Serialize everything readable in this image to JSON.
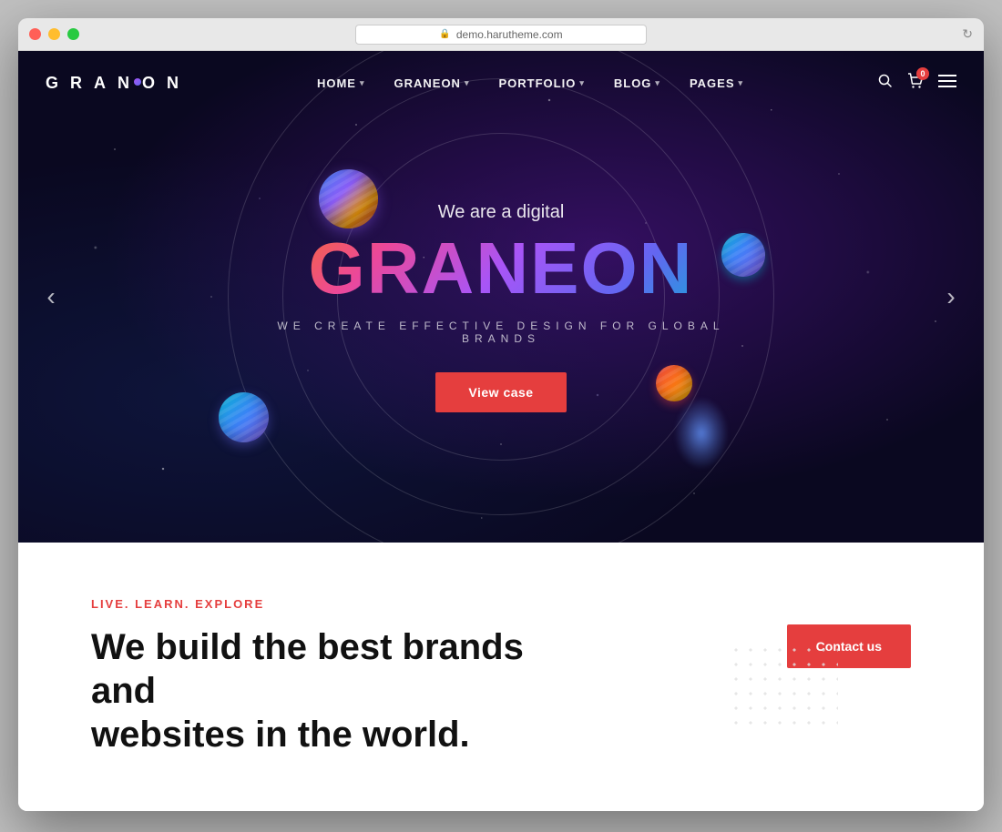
{
  "window": {
    "url": "demo.harutheme.com"
  },
  "navbar": {
    "logo": "GRANEON",
    "menu": [
      {
        "label": "HOME",
        "has_dropdown": true
      },
      {
        "label": "GRANEON",
        "has_dropdown": true
      },
      {
        "label": "PORTFOLIO",
        "has_dropdown": true
      },
      {
        "label": "BLOG",
        "has_dropdown": true
      },
      {
        "label": "PAGES",
        "has_dropdown": true
      }
    ],
    "cart_count": "0"
  },
  "hero": {
    "subtitle": "We are a digital",
    "title": "GRANEON",
    "tagline": "WE CREATE EFFECTIVE DESIGN FOR GLOBAL BRANDS",
    "cta_button": "View case"
  },
  "carousel": {
    "prev_arrow": "‹",
    "next_arrow": "›"
  },
  "below_fold": {
    "tag": "LIVE. LEARN. EXPLORE",
    "heading_line1": "We build the best brands and",
    "heading_line2": "websites in the world.",
    "contact_button": "Contact us"
  }
}
